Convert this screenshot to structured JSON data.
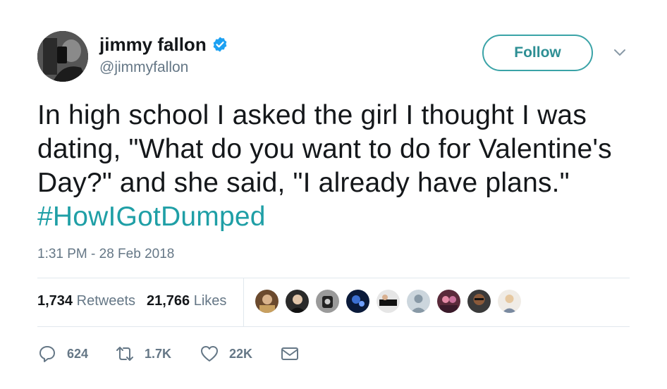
{
  "user": {
    "name": "jimmy fallon",
    "handle": "@jimmyfallon",
    "verified": true,
    "avatar_icon": "profile-photo"
  },
  "follow": {
    "label": "Follow"
  },
  "tweet": {
    "text": "In high school I asked the girl I thought I was dating, \"What do you want to do for Valentine's Day?\" and she said, \"I already have plans.\" ",
    "hashtag": "#HowIGotDumped",
    "timestamp": "1:31 PM - 28 Feb 2018"
  },
  "stats": {
    "retweets_count": "1,734",
    "retweets_label": "Retweets",
    "likes_count": "21,766",
    "likes_label": "Likes"
  },
  "actions": {
    "replies": "624",
    "retweets": "1.7K",
    "likes": "22K"
  },
  "colors": {
    "accent": "#1f9fa6",
    "muted": "#657786",
    "text": "#14171a",
    "verified": "#1da1f2"
  }
}
